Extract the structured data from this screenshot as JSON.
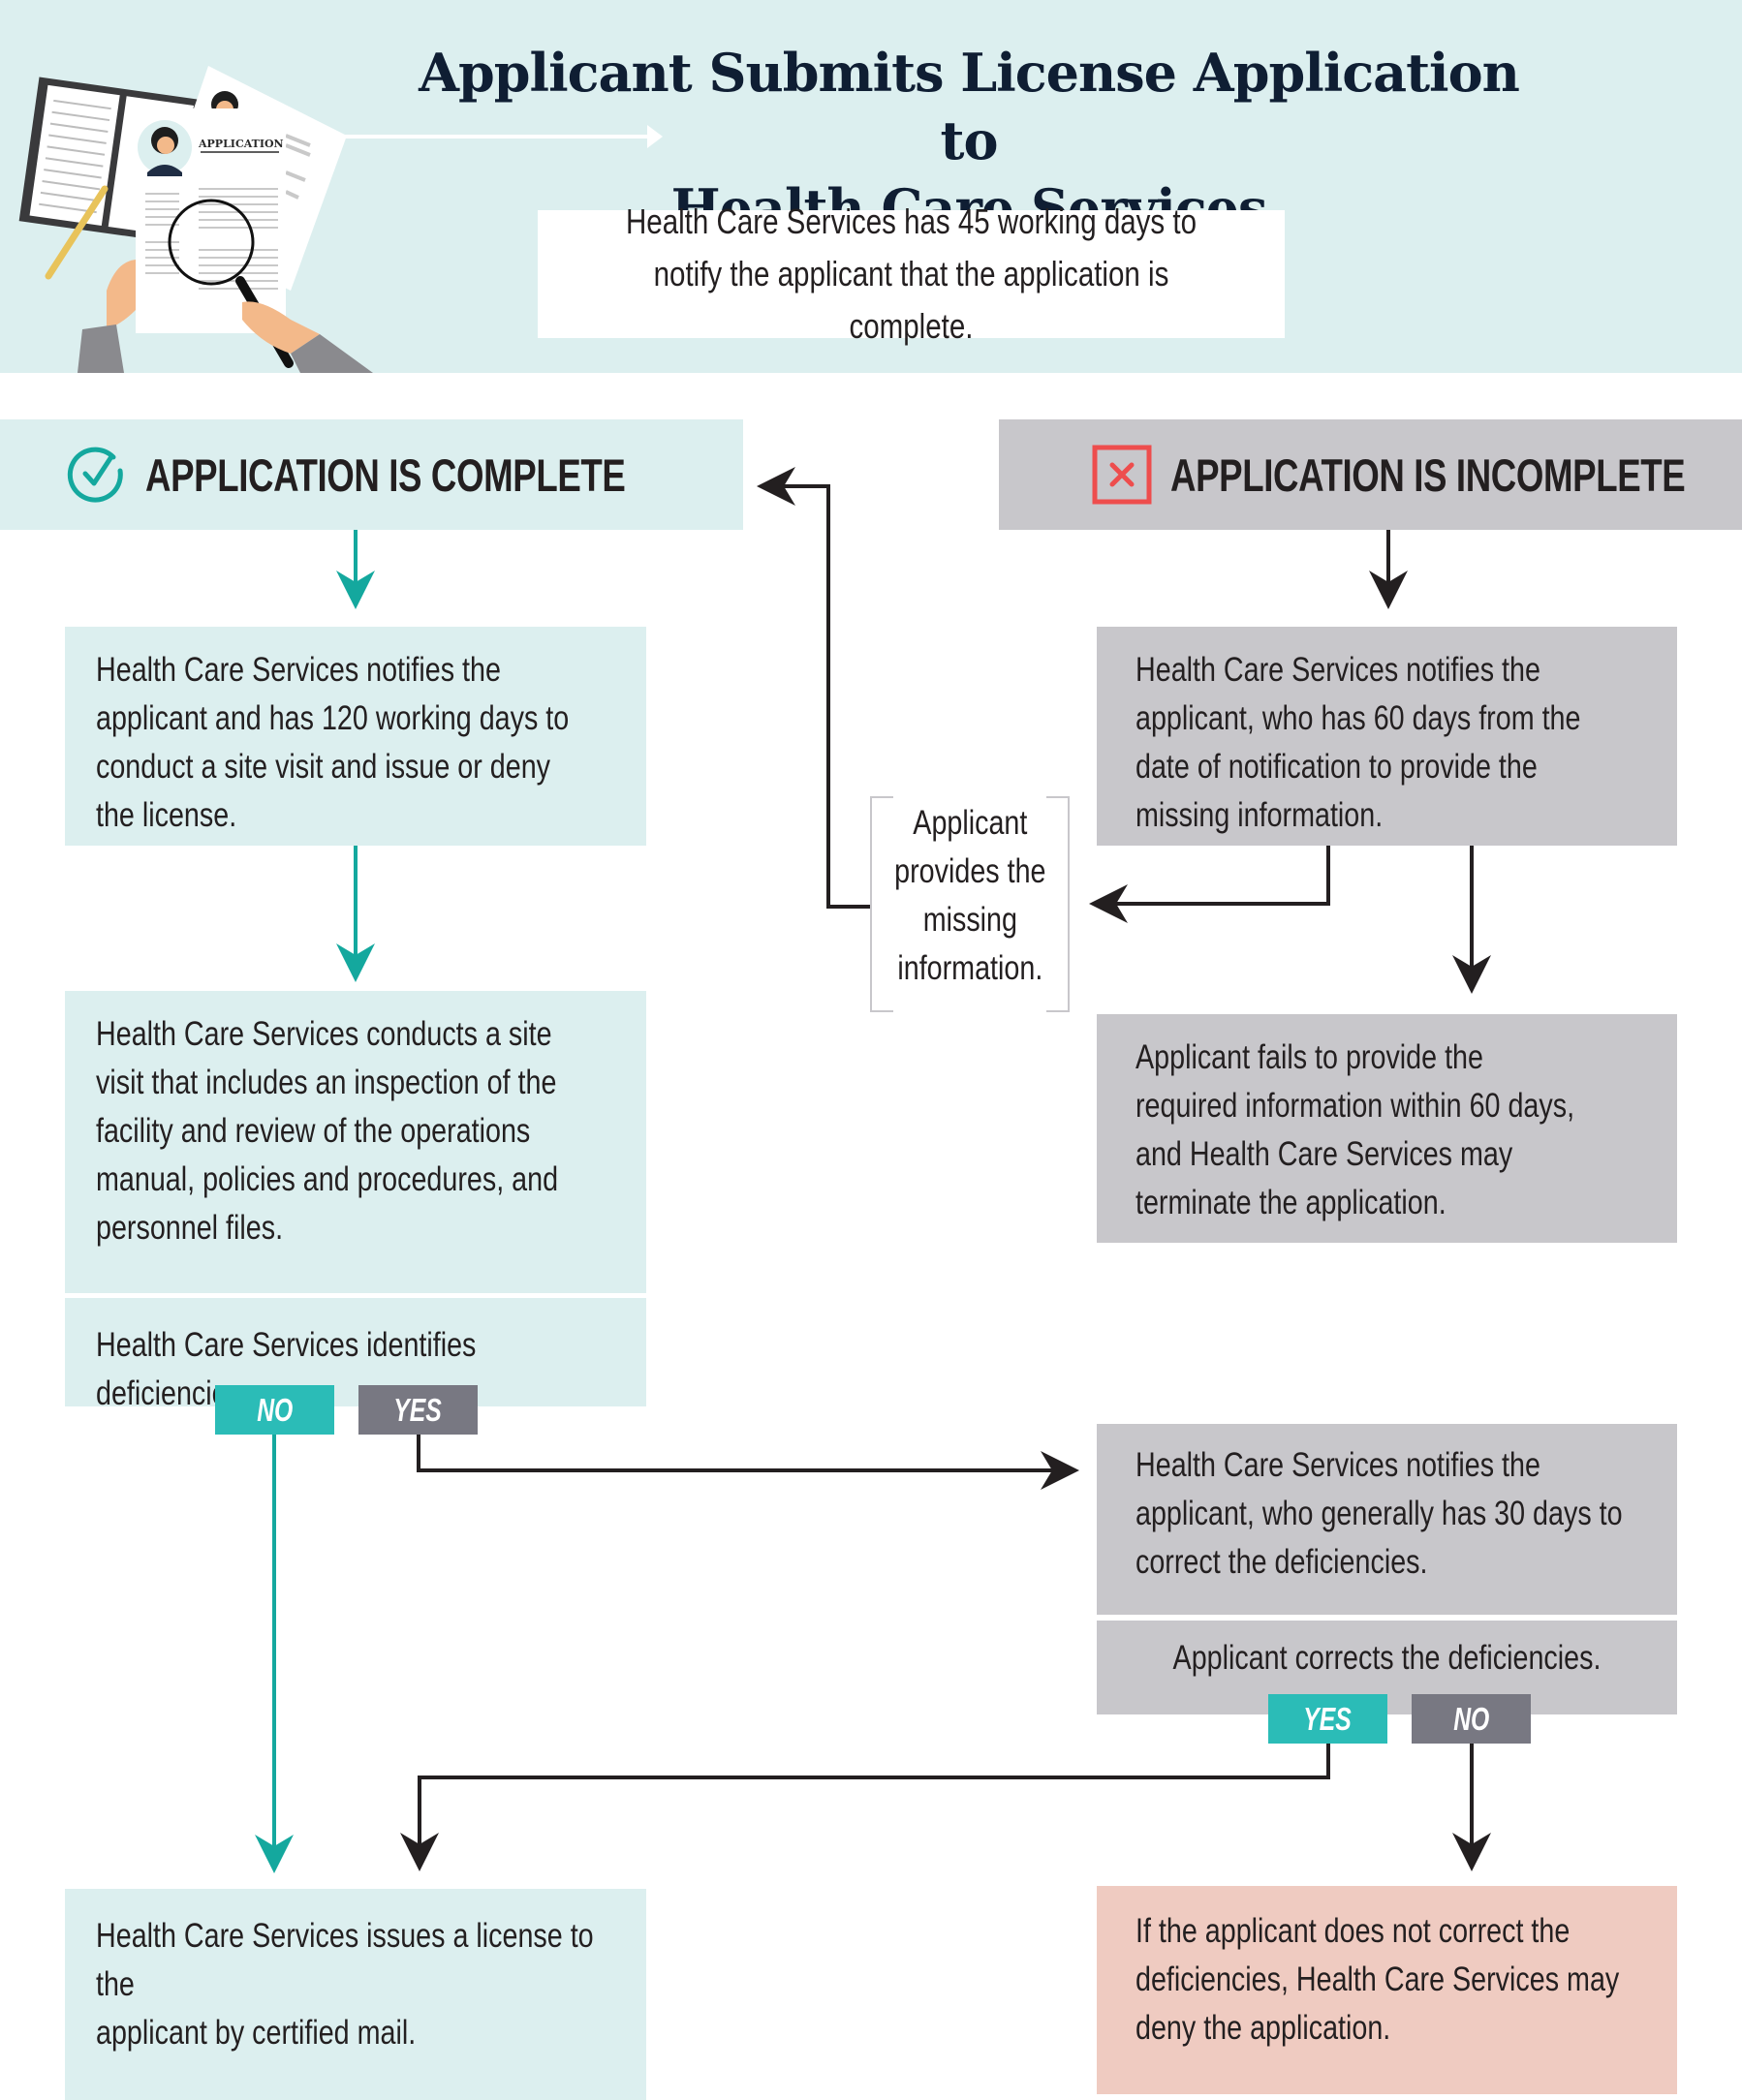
{
  "header": {
    "title_line1": "Applicant Submits License Application to",
    "title_line2": "Health Care Services",
    "illustration_label": "APPLICATION",
    "note": "Health Care Services has 45 working days to notify the applicant that the application is complete."
  },
  "branches": {
    "complete": {
      "label": "APPLICATION IS COMPLETE",
      "icon": "check-circle-icon",
      "color": "#14a89e"
    },
    "incomplete": {
      "label": "APPLICATION IS INCOMPLETE",
      "icon": "x-square-icon",
      "color": "#ee4d4d"
    }
  },
  "steps": {
    "complete_notify": "Health Care Services notifies the\napplicant and has 120 working days to\nconduct a site visit and issue or deny\nthe license.",
    "site_visit": "Health Care Services conducts a site\nvisit that includes an inspection of  the\nfacility and review of the operations\nmanual, policies and procedures, and\npersonnel files.",
    "identifies_deficiencies": "Health Care Services identifies deficiencies.",
    "incomplete_notify": "Health Care Services notifies the\napplicant, who has 60 days from the\ndate of notification to provide the\nmissing information.",
    "provides_missing": "Applicant\nprovides the\nmissing\ninformation.",
    "fails_to_provide": "Applicant fails to provide the\nrequired information within 60 days,\nand Health Care Services may\nterminate the application.",
    "deficiency_notify": "Health Care Services notifies the\napplicant, who generally has 30 days to\ncorrect the deficiencies.",
    "corrects_deficiencies": "Applicant corrects the deficiencies.",
    "issues_license": "Health Care Services issues a license to the\napplicant by certified mail.",
    "deny_application": "If the applicant does not correct the\ndeficiencies, Health Care Services may\ndeny the application."
  },
  "decisions": {
    "deficiencies_no": "NO",
    "deficiencies_yes": "YES",
    "corrects_yes": "YES",
    "corrects_no": "NO"
  },
  "colors": {
    "teal_bg": "#dcefef",
    "gray_bg": "#c8c7cb",
    "pink_bg": "#efcbc1",
    "teal_tag": "#2bbcb7",
    "gray_tag": "#787882",
    "teal_arrow": "#14a89e",
    "dark_arrow": "#231f20",
    "title": "#0f1e33"
  }
}
